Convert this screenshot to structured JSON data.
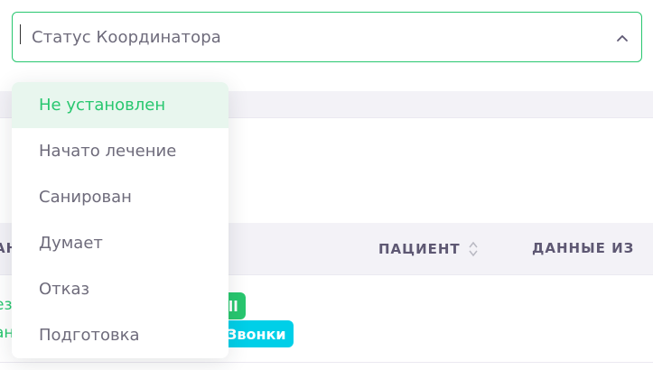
{
  "select": {
    "placeholder": "Статус Координатора",
    "icon": "chevron-up-icon",
    "border_color": "#28c76f"
  },
  "dropdown": {
    "items": [
      {
        "label": "Не установлен",
        "active": true
      },
      {
        "label": "Начато лечение",
        "active": false
      },
      {
        "label": "Санирован",
        "active": false
      },
      {
        "label": "Думает",
        "active": false
      },
      {
        "label": "Отказ",
        "active": false
      },
      {
        "label": "Подготовка",
        "active": false
      }
    ],
    "active_bg": "#e8f6ee",
    "active_color": "#28c76f"
  },
  "table": {
    "headers": {
      "partial_left": "АН",
      "patient": "ПАЦИЕНТ",
      "data": "ДАННЫЕ ИЗ"
    },
    "row": {
      "text_line1": "ез",
      "text_line2": "ан",
      "badge_green": "all",
      "badge_cyan": "Звонки"
    }
  },
  "colors": {
    "accent_green": "#28c76f",
    "accent_cyan": "#00cfe8",
    "text": "#6e6b7b"
  }
}
